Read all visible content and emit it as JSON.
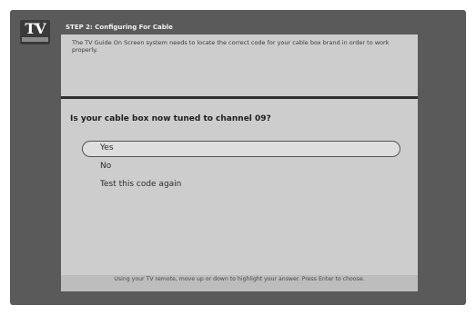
{
  "header": {
    "logo_text": "TV",
    "step_title": "STEP 2: Configuring For Cable"
  },
  "intro_text": "The TV Guide On Screen system needs to locate the correct code for your cable box brand in order to work properly.",
  "question": "Is your cable box now tuned to channel 09?",
  "options": [
    {
      "label": "Yes",
      "selected": true
    },
    {
      "label": "No",
      "selected": false
    },
    {
      "label": "Test this code again",
      "selected": false
    }
  ],
  "footer_hint": "Using your TV remote, move up or down to highlight your answer. Press Enter to choose."
}
